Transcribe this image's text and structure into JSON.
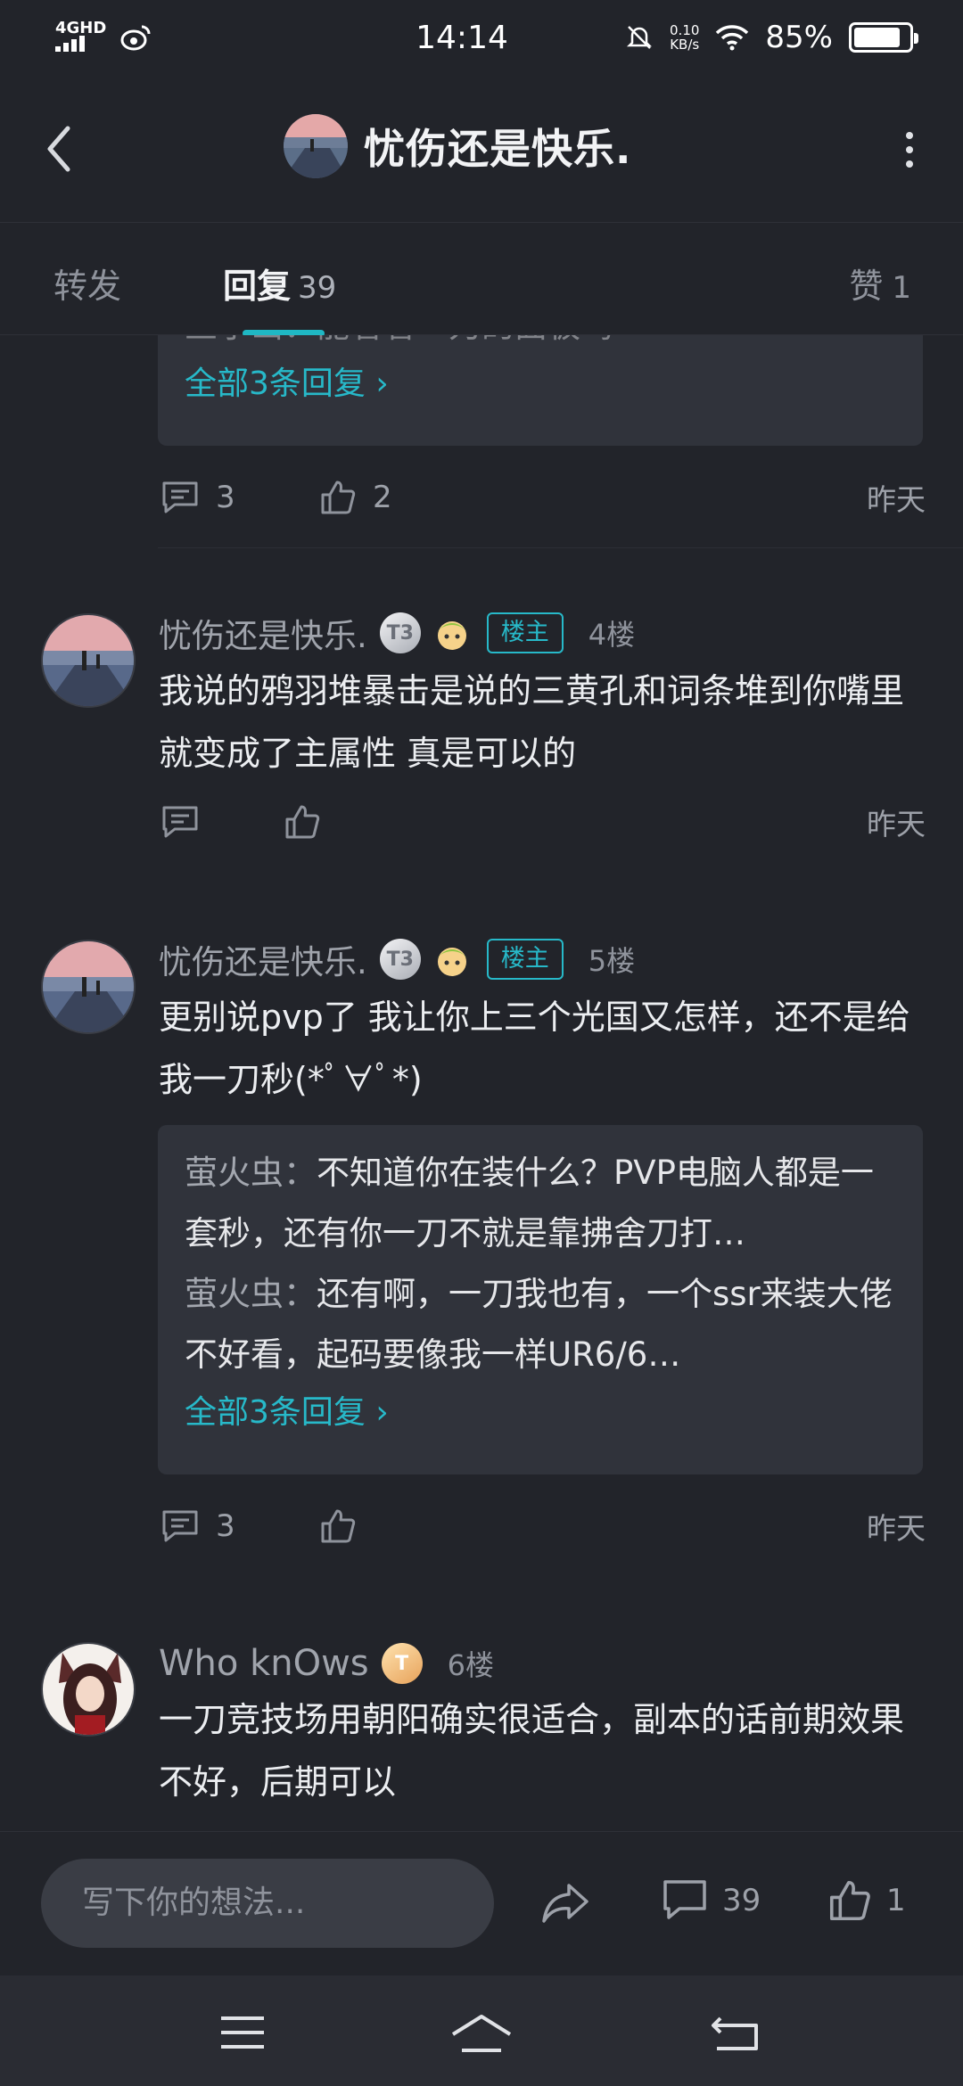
{
  "status_bar": {
    "network": "4GHD",
    "time": "14:14",
    "speed_value": "0.10",
    "speed_unit": "KB/s",
    "battery": "85%",
    "battery_level": 0.85
  },
  "header": {
    "title": "忧伤还是快乐."
  },
  "tabs": {
    "forward": "转发",
    "reply": "回复",
    "reply_count": "39",
    "like": "赞",
    "like_count": "1"
  },
  "prev_comment": {
    "reply_partial": "鱼小山：能看看一刀的面板吗",
    "view_all": "全部3条回复 ›",
    "comment_count": "3",
    "like_count": "2",
    "time": "昨天"
  },
  "comments": [
    {
      "name": "忧伤还是快乐.",
      "level": "T3",
      "owner_badge": "楼主",
      "floor": "4楼",
      "body": "我说的鸦羽堆暴击是说的三黄孔和词条堆到你嘴里就变成了主属性 真是可以的",
      "time": "昨天"
    },
    {
      "name": "忧伤还是快乐.",
      "level": "T3",
      "owner_badge": "楼主",
      "floor": "5楼",
      "body": "更别说pvp了 我让你上三个光国又怎样，还不是给我一刀秒(*ﾟ∀ﾟ*)",
      "replies": [
        {
          "who": "萤火虫",
          "sep": "：",
          "text": "不知道你在装什么？PVP电脑人都是一套秒，还有你一刀不就是靠拂舍刀打…"
        },
        {
          "who": "萤火虫",
          "sep": "：",
          "text": "还有啊，一刀我也有，一个ssr来装大佬不好看，起码要像我一样UR6/6…"
        }
      ],
      "view_all": "全部3条回复 ›",
      "comment_count": "3",
      "time": "昨天"
    },
    {
      "name": "Who knOws",
      "level": "T",
      "floor": "6楼",
      "body": "一刀竞技场用朝阳确实很适合，副本的话前期效果不好，后期可以"
    }
  ],
  "bottom_bar": {
    "placeholder": "写下你的想法...",
    "comment_count": "39",
    "like_count": "1"
  },
  "colors": {
    "background": "#22242a",
    "card": "#30333b",
    "accent": "#27b9c9",
    "muted": "#9da1a9"
  }
}
